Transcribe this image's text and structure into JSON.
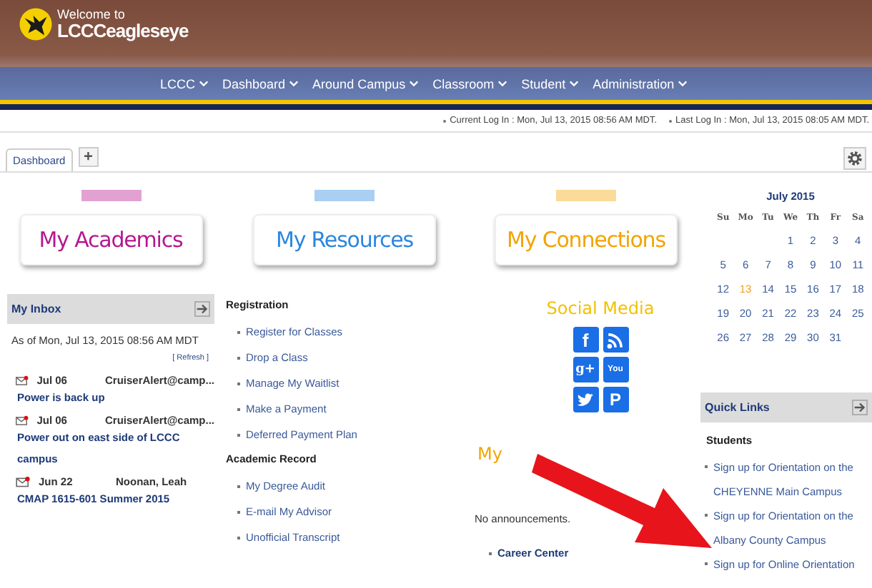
{
  "header": {
    "welcome": "Welcome to",
    "site_name": "LCCCeagleseye",
    "nav": [
      {
        "label": "LCCC"
      },
      {
        "label": "Dashboard"
      },
      {
        "label": "Around Campus"
      },
      {
        "label": "Classroom"
      },
      {
        "label": "Student"
      },
      {
        "label": "Administration"
      }
    ]
  },
  "login_info": [
    "Current Log In : Mon, Jul 13, 2015 08:56 AM MDT.",
    "Last Log In : Mon, Jul 13, 2015 08:05 AM MDT."
  ],
  "tabs": [
    {
      "label": "Dashboard",
      "selected": true
    }
  ],
  "add_tab": "+",
  "cards": [
    {
      "label": "My Academics",
      "color": "#b5178f"
    },
    {
      "label": "My Resources",
      "color": "#2b86e0"
    },
    {
      "label": "My Connections",
      "color": "#f2a400"
    }
  ],
  "inbox": {
    "title": "My Inbox",
    "as_of": "As of Mon, Jul 13, 2015 08:56 AM MDT",
    "refresh": "[ Refresh ]",
    "messages": [
      {
        "date": "Jul 06",
        "sender": "CruiserAlert@camp...",
        "subject": "Power is back up"
      },
      {
        "date": "Jul 06",
        "sender": "CruiserAlert@camp...",
        "subject": "Power out on east side of LCCC campus"
      },
      {
        "date": "Jun 22",
        "sender": "Noonan, Leah",
        "subject": "CMAP 1615-601 Summer 2015"
      }
    ]
  },
  "links": [
    {
      "heading": "Registration",
      "items": [
        "Register for Classes",
        "Drop a Class",
        "Manage My Waitlist",
        "Make a Payment",
        "Deferred Payment Plan"
      ]
    },
    {
      "heading": "Academic Record",
      "items": [
        "My Degree Audit",
        "E-mail My Advisor",
        "Unofficial Transcript"
      ]
    }
  ],
  "social": {
    "title": "Social Media",
    "icons": [
      {
        "kind": "facebook",
        "glyph": "f"
      },
      {
        "kind": "rss"
      },
      {
        "kind": "googleplus",
        "glyph": "g+"
      },
      {
        "kind": "youtube",
        "glyph": "You"
      },
      {
        "kind": "twitter"
      },
      {
        "kind": "pinterest",
        "glyph": "P"
      }
    ]
  },
  "partial_heading": "My",
  "announcements": "No announcements.",
  "center_links": [
    "Career Center"
  ],
  "calendar": {
    "title": "July 2015",
    "weekdays": [
      "Su",
      "Mo",
      "Tu",
      "We",
      "Th",
      "Fr",
      "Sa"
    ],
    "weeks": [
      [
        {
          "day": "1",
          "today": false
        },
        {
          "day": "2",
          "today": false
        },
        {
          "day": "3",
          "today": false
        },
        {
          "day": "4",
          "today": false
        }
      ],
      [
        {
          "day": "5",
          "today": false
        },
        {
          "day": "6",
          "today": false
        },
        {
          "day": "7",
          "today": false
        },
        {
          "day": "8",
          "today": false
        },
        {
          "day": "9",
          "today": false
        },
        {
          "day": "10",
          "today": false
        },
        {
          "day": "11",
          "today": false
        }
      ],
      [
        {
          "day": "12",
          "today": false
        },
        {
          "day": "13",
          "today": true
        },
        {
          "day": "14",
          "today": false
        },
        {
          "day": "15",
          "today": false
        },
        {
          "day": "16",
          "today": false
        },
        {
          "day": "17",
          "today": false
        },
        {
          "day": "18",
          "today": false
        }
      ],
      [
        {
          "day": "19",
          "today": false
        },
        {
          "day": "20",
          "today": false
        },
        {
          "day": "21",
          "today": false
        },
        {
          "day": "22",
          "today": false
        },
        {
          "day": "23",
          "today": false
        },
        {
          "day": "24",
          "today": false
        },
        {
          "day": "25",
          "today": false
        }
      ],
      [
        {
          "day": "26",
          "today": false
        },
        {
          "day": "27",
          "today": false
        },
        {
          "day": "28",
          "today": false
        },
        {
          "day": "29",
          "today": false
        },
        {
          "day": "30",
          "today": false
        },
        {
          "day": "31",
          "today": false
        }
      ]
    ]
  },
  "quick_links": {
    "title": "Quick Links",
    "heading": "Students",
    "items": [
      "Sign up for Orientation on the CHEYENNE Main Campus",
      "Sign up for Orientation on the Albany County Campus",
      "Sign up for Online Orientation"
    ]
  }
}
